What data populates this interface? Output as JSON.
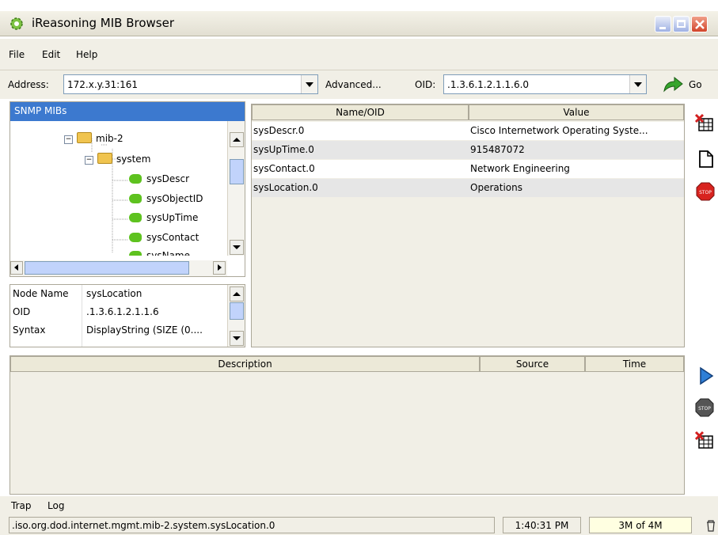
{
  "window": {
    "title": "iReasoning MIB Browser"
  },
  "menu": [
    "File",
    "Edit",
    "Help"
  ],
  "address": {
    "label": "Address:",
    "value": "172.x.y.31:161",
    "advanced": "Advanced...",
    "oid_label": "OID:",
    "oid_value": ".1.3.6.1.2.1.1.6.0",
    "go": "Go"
  },
  "tree": {
    "header": "SNMP MIBs",
    "items": [
      "mib-2",
      "system",
      "sysDescr",
      "sysObjectID",
      "sysUpTime",
      "sysContact",
      "sysName"
    ]
  },
  "node_info": {
    "rows": [
      {
        "key": "Node Name",
        "val": "sysLocation"
      },
      {
        "key": "OID",
        "val": ".1.3.6.1.2.1.1.6"
      },
      {
        "key": "Syntax",
        "val": "DisplayString (SIZE (0...."
      }
    ]
  },
  "results": {
    "columns": [
      "Name/OID",
      "Value"
    ],
    "rows": [
      {
        "name": "sysDescr.0",
        "value": "Cisco Internetwork Operating Syste..."
      },
      {
        "name": "sysUpTime.0",
        "value": "915487072"
      },
      {
        "name": "sysContact.0",
        "value": "Network Engineering"
      },
      {
        "name": "sysLocation.0",
        "value": "Operations"
      }
    ]
  },
  "trap_table": {
    "columns": [
      "Description",
      "Source",
      "Time"
    ]
  },
  "tabs": [
    "Trap",
    "Log"
  ],
  "status": {
    "path": ".iso.org.dod.internet.mgmt.mib-2.system.sysLocation.0",
    "time": "1:40:31 PM",
    "memory": "3M of 4M"
  },
  "colors": {
    "accent": "#316ac5",
    "row_alt": "#e6e6e6",
    "memory_bg": "#ffffe1"
  }
}
